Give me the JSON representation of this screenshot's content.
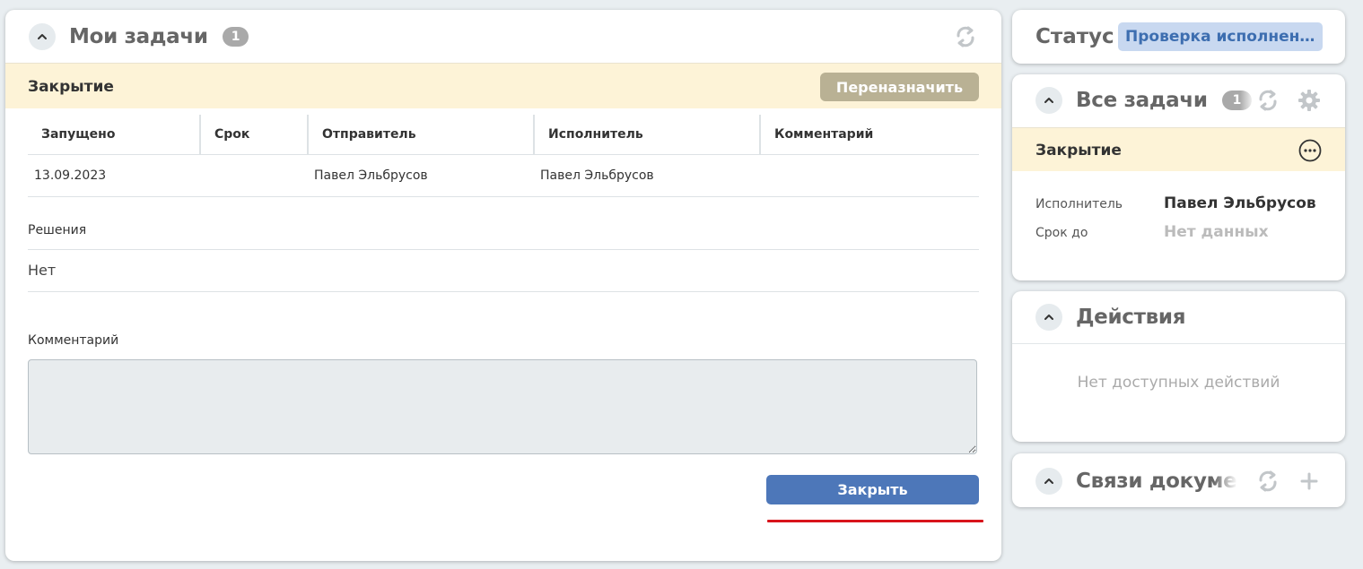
{
  "my_tasks": {
    "title": "Мои задачи",
    "count": "1",
    "task_name": "Закрытие",
    "reassign_label": "Переназначить",
    "table": {
      "headers": [
        "Запущено",
        "Срок",
        "Отправитель",
        "Исполнитель",
        "Комментарий"
      ],
      "rows": [
        [
          "13.09.2023",
          "",
          "Павел Эльбрусов",
          "Павел Эльбрусов",
          ""
        ]
      ]
    },
    "decisions_label": "Решения",
    "decisions_value": "Нет",
    "comment_label": "Комментарий",
    "comment_value": "",
    "close_label": "Закрыть"
  },
  "status": {
    "label": "Статус",
    "value": "Проверка исполнения"
  },
  "all_tasks": {
    "title": "Все задачи",
    "count": "1",
    "task_name": "Закрытие",
    "executor_label": "Исполнитель",
    "executor_value": "Павел Эльбрусов",
    "deadline_label": "Срок до",
    "deadline_value": "Нет данных"
  },
  "actions": {
    "title": "Действия",
    "empty_text": "Нет доступных действий"
  },
  "links": {
    "title": "Связи документа"
  },
  "icons": {
    "collapse": "chevron-up-icon",
    "refresh": "refresh-icon",
    "settings": "gear-icon",
    "more": "more-horizontal-icon",
    "add": "plus-icon"
  },
  "colors": {
    "accent": "#4d77b9",
    "task_bar": "#fdf3d7",
    "reassign": "#b9b194",
    "status_pill": "#c8d8f0",
    "highlight_line": "#d8141b"
  }
}
